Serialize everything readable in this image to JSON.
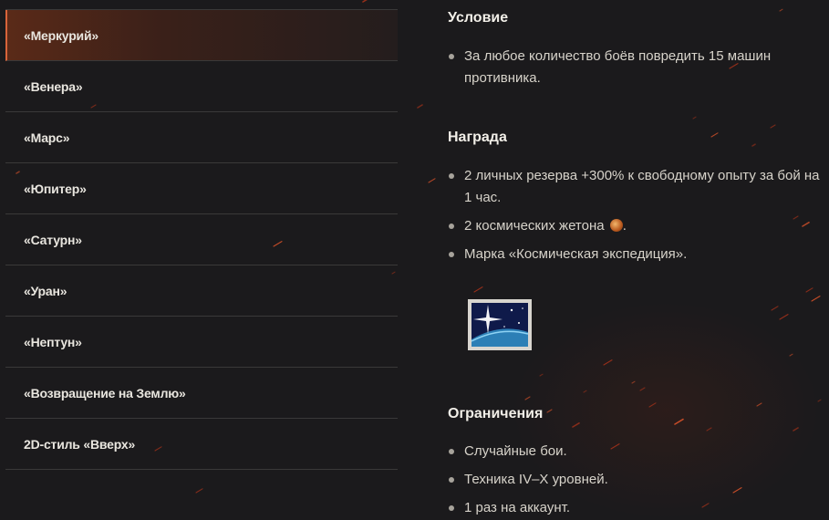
{
  "menu": {
    "items": [
      {
        "label": "«Меркурий»",
        "active": true
      },
      {
        "label": "«Венера»"
      },
      {
        "label": "«Марс»"
      },
      {
        "label": "«Юпитер»"
      },
      {
        "label": "«Сатурн»"
      },
      {
        "label": "«Уран»"
      },
      {
        "label": "«Нептун»"
      },
      {
        "label": "«Возвращение на Землю»"
      },
      {
        "label": "2D-стиль «Вверх»"
      }
    ]
  },
  "condition": {
    "title": "Условие",
    "items": [
      "За любое количество боёв повредить 15 машин противника."
    ]
  },
  "reward": {
    "title": "Награда",
    "items": [
      "2 личных резерва +300% к свободному опыту за бой на 1 час.",
      "2 космических жетона",
      "Марка «Космическая экспедиция»."
    ],
    "token_suffix": ".",
    "token_icon": "space-token-icon",
    "stamp_icon": "space-expedition-stamp-icon"
  },
  "restrictions": {
    "title": "Ограничения",
    "items": [
      "Случайные бои.",
      "Техника IV–X уровней.",
      "1 раз на аккаунт."
    ]
  },
  "colors": {
    "background": "#1b1a1c",
    "accent": "#d9643a",
    "text": "#d7d3ca",
    "heading": "#f2efe8"
  }
}
